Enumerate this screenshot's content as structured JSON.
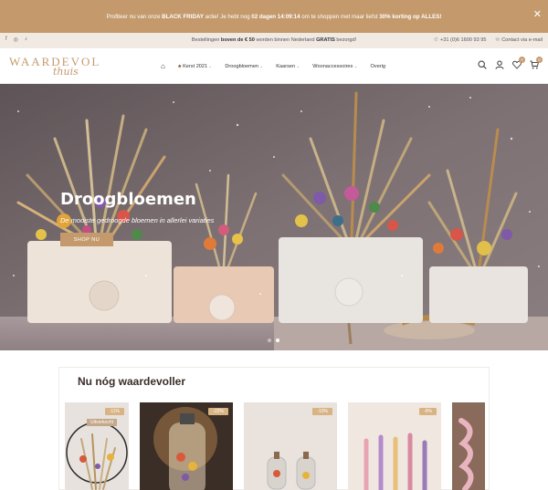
{
  "promo": {
    "text_before": "Profiteer nu van onze ",
    "text_bold1": "BLACK FRIDAY",
    "text_mid1": " actie! Je hebt nog ",
    "text_bold2": "02 dagen 14:09:14",
    "text_mid2": " om te shoppen met maar liefst ",
    "text_bold3": "30% korting op ALLES!",
    "close_icon": "close-icon"
  },
  "infobar": {
    "social_icons": [
      "facebook-icon",
      "instagram-icon",
      "tiktok-icon"
    ],
    "social_glyphs": [
      "f",
      "◎",
      "♪"
    ],
    "shipping_before": "Bestellingen ",
    "shipping_bold1": "boven de € 50",
    "shipping_mid": " worden binnen Nederland ",
    "shipping_bold2": "GRATIS",
    "shipping_after": " bezorgd!",
    "phone": "+31 (0)6 1600 93 95",
    "email": "Contact via e-mail"
  },
  "header": {
    "logo_word": "WAARDEVOL",
    "logo_script": "thuis",
    "nav": [
      {
        "label": "Kerst 2021",
        "has_caret": true
      },
      {
        "label": "Droogbloemen",
        "has_caret": true
      },
      {
        "label": "Kaarsen",
        "has_caret": true
      },
      {
        "label": "Woonaccessoires",
        "has_caret": true
      },
      {
        "label": "Overig",
        "has_caret": false
      }
    ],
    "wishlist_count": "0",
    "cart_count": "0"
  },
  "hero": {
    "title": "Droogbloemen",
    "subtitle": "De mooiste gedroogde bloemen in allerlei variaties",
    "button": "SHOP NU",
    "slide_count": 2,
    "active_slide": 2,
    "pot_labels": [
      "WAARDEVOL thuis",
      "WAARDEVOL thuis",
      "WAARDEVOL thuis",
      "WAARDEVOL thuis"
    ]
  },
  "section": {
    "title": "Nu nóg waardevoller",
    "products": [
      {
        "badge": "-11%",
        "status": "Uitverkocht"
      },
      {
        "badge": "-22%",
        "status": ""
      },
      {
        "badge": "-10%",
        "status": ""
      },
      {
        "badge": "-6%",
        "status": ""
      },
      {
        "badge": "",
        "status": ""
      }
    ]
  },
  "colors": {
    "accent": "#c49a6c",
    "infobar_bg": "#f1eae3",
    "hero_bg": "#6d6064"
  }
}
